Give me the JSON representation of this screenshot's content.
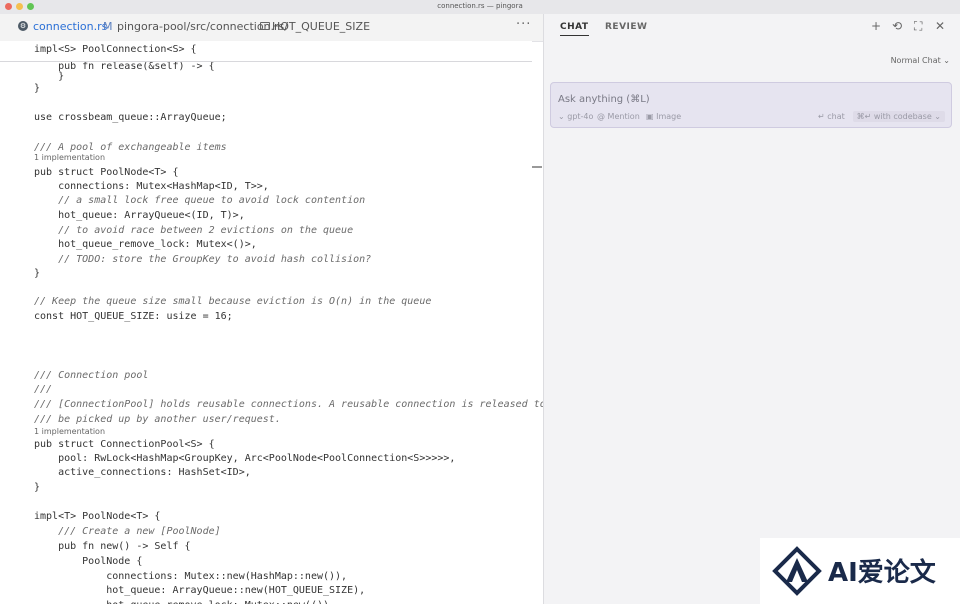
{
  "window": {
    "title": "connection.rs — pingora"
  },
  "traffic_lights": [
    "#ec6a5e",
    "#f4bf4f",
    "#61c554"
  ],
  "editor": {
    "tab": {
      "icon": "rust-file-icon",
      "filename": "connection.rs",
      "modified": "M",
      "path": "pingora-pool/src/connection.rs/",
      "symbol": "HOT_QUEUE_SIZE",
      "more": "···"
    },
    "sticky": "impl<S> PoolConnection<S> {",
    "lens": [
      "1 implementation",
      "1 implementation"
    ],
    "lines": [
      "    pub fn release(&self) -> {",
      "    }",
      "}",
      "",
      "use crossbeam_queue::ArrayQueue;",
      "",
      "/// A pool of exchangeable items",
      "pub struct PoolNode<T> {",
      "    connections: Mutex<HashMap<ID, T>>,",
      "    // a small lock free queue to avoid lock contention",
      "    hot_queue: ArrayQueue<(ID, T)>,",
      "    // to avoid race between 2 evictions on the queue",
      "    hot_queue_remove_lock: Mutex<()>,",
      "    // TODO: store the GroupKey to avoid hash collision?",
      "}",
      "",
      "// Keep the queue size small because eviction is O(n) in the queue",
      "const HOT_QUEUE_SIZE: usize = 16;",
      "",
      "",
      "",
      "/// Connection pool",
      "///",
      "/// [ConnectionPool] holds reusable connections. A reusable connection is released to t",
      "/// be picked up by another user/request.",
      "pub struct ConnectionPool<S> {",
      "    pool: RwLock<HashMap<GroupKey, Arc<PoolNode<PoolConnection<S>>>>>,",
      "    active_connections: HashSet<ID>,",
      "}",
      "",
      "impl<T> PoolNode<T> {",
      "    /// Create a new [PoolNode]",
      "    pub fn new() -> Self {",
      "        PoolNode {",
      "            connections: Mutex::new(HashMap::new()),",
      "            hot_queue: ArrayQueue::new(HOT_QUEUE_SIZE),",
      "            hot_queue_remove_lock: Mutex::new(())"
    ]
  },
  "chat": {
    "tabs": [
      "CHAT",
      "REVIEW"
    ],
    "actions": [
      {
        "icon": "plus-icon",
        "glyph": "+"
      },
      {
        "icon": "history-icon",
        "glyph": "⟲"
      },
      {
        "icon": "expand-icon",
        "glyph": "⛶"
      },
      {
        "icon": "close-icon",
        "glyph": "✕"
      }
    ],
    "mode": "Normal Chat ⌄",
    "input_placeholder": "Ask anything (⌘L)",
    "model": "⌄ gpt-4o",
    "mention": "@ Mention",
    "image": "▣ Image",
    "submit_chat": "↵ chat",
    "submit_codebase": "⌘↵ with codebase ⌄"
  },
  "watermark": {
    "text": "AI爱论文",
    "icon": "ai-logo-icon"
  }
}
